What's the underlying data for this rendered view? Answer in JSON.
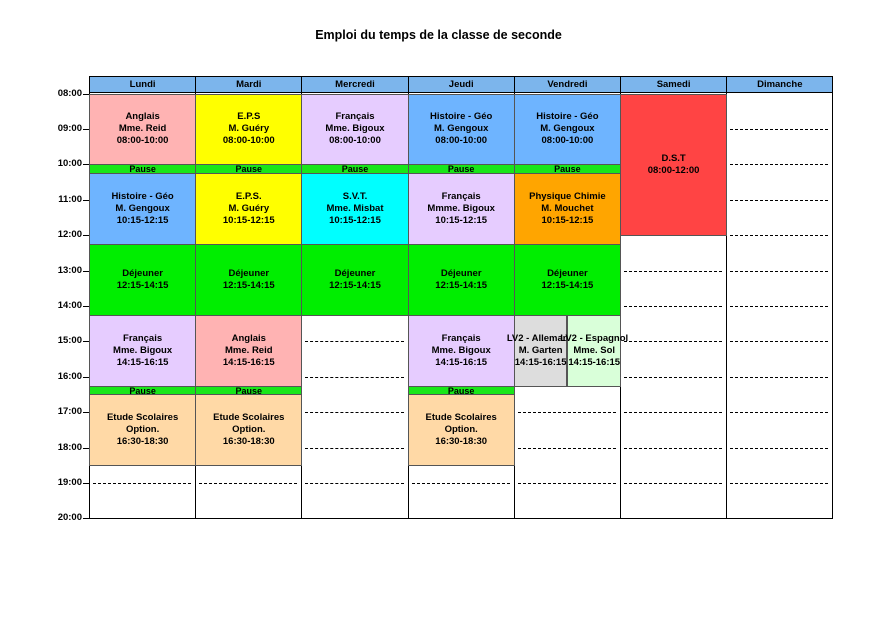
{
  "title": "Emploi du temps de la classe de seconde",
  "days": [
    "Lundi",
    "Mardi",
    "Mercredi",
    "Jeudi",
    "Vendredi",
    "Samedi",
    "Dimanche"
  ],
  "hours": [
    "08:00",
    "09:00",
    "10:00",
    "11:00",
    "12:00",
    "13:00",
    "14:00",
    "15:00",
    "16:00",
    "17:00",
    "18:00",
    "19:00",
    "20:00"
  ],
  "colors": {
    "header": "#7cb5ec",
    "anglais": "#ffb3b3",
    "eps": "#ffff00",
    "francais": "#e6ccff",
    "histoire": "#6eb4ff",
    "pause": "#19e619",
    "svt": "#00ffff",
    "physique": "#ffa500",
    "dejeuner": "#00ee00",
    "etude": "#ffd9a6",
    "dst": "#ff4444",
    "lv2_allemand": "#dddddd",
    "lv2_espagnol": "#d9ffd9"
  },
  "events": [
    {
      "day": 0,
      "start": 8.0,
      "end": 10.0,
      "color": "anglais",
      "lines": [
        "Anglais",
        "Mme. Reid",
        "08:00-10:00"
      ]
    },
    {
      "day": 1,
      "start": 8.0,
      "end": 10.0,
      "color": "eps",
      "lines": [
        "E.P.S",
        "M. Guéry",
        "08:00-10:00"
      ]
    },
    {
      "day": 2,
      "start": 8.0,
      "end": 10.0,
      "color": "francais",
      "lines": [
        "Français",
        "Mme. Bigoux",
        "08:00-10:00"
      ]
    },
    {
      "day": 3,
      "start": 8.0,
      "end": 10.0,
      "color": "histoire",
      "lines": [
        "Histoire - Géo",
        "M. Gengoux",
        "08:00-10:00"
      ]
    },
    {
      "day": 4,
      "start": 8.0,
      "end": 10.0,
      "color": "histoire",
      "lines": [
        "Histoire - Géo",
        "M. Gengoux",
        "08:00-10:00"
      ]
    },
    {
      "day": 5,
      "start": 8.0,
      "end": 12.0,
      "color": "dst",
      "lines": [
        "D.S.T",
        "08:00-12:00"
      ]
    },
    {
      "day": 0,
      "start": 10.0,
      "end": 10.25,
      "color": "pause",
      "pause": true,
      "lines": [
        "Pause"
      ]
    },
    {
      "day": 1,
      "start": 10.0,
      "end": 10.25,
      "color": "pause",
      "pause": true,
      "lines": [
        "Pause"
      ]
    },
    {
      "day": 2,
      "start": 10.0,
      "end": 10.25,
      "color": "pause",
      "pause": true,
      "lines": [
        "Pause"
      ]
    },
    {
      "day": 3,
      "start": 10.0,
      "end": 10.25,
      "color": "pause",
      "pause": true,
      "lines": [
        "Pause"
      ]
    },
    {
      "day": 4,
      "start": 10.0,
      "end": 10.25,
      "color": "pause",
      "pause": true,
      "lines": [
        "Pause"
      ]
    },
    {
      "day": 0,
      "start": 10.25,
      "end": 12.25,
      "color": "histoire",
      "lines": [
        "Histoire - Géo",
        "M. Gengoux",
        "10:15-12:15"
      ]
    },
    {
      "day": 1,
      "start": 10.25,
      "end": 12.25,
      "color": "eps",
      "lines": [
        "E.P.S.",
        "M. Guéry",
        "10:15-12:15"
      ]
    },
    {
      "day": 2,
      "start": 10.25,
      "end": 12.25,
      "color": "svt",
      "lines": [
        "S.V.T.",
        "Mme. Misbat",
        "10:15-12:15"
      ]
    },
    {
      "day": 3,
      "start": 10.25,
      "end": 12.25,
      "color": "francais",
      "lines": [
        "Français",
        "Mmme. Bigoux",
        "10:15-12:15"
      ]
    },
    {
      "day": 4,
      "start": 10.25,
      "end": 12.25,
      "color": "physique",
      "lines": [
        "Physique Chimie",
        "M. Mouchet",
        "10:15-12:15"
      ]
    },
    {
      "day": 0,
      "start": 12.25,
      "end": 14.25,
      "color": "dejeuner",
      "lines": [
        "Déjeuner",
        "12:15-14:15"
      ]
    },
    {
      "day": 1,
      "start": 12.25,
      "end": 14.25,
      "color": "dejeuner",
      "lines": [
        "Déjeuner",
        "12:15-14:15"
      ]
    },
    {
      "day": 2,
      "start": 12.25,
      "end": 14.25,
      "color": "dejeuner",
      "lines": [
        "Déjeuner",
        "12:15-14:15"
      ]
    },
    {
      "day": 3,
      "start": 12.25,
      "end": 14.25,
      "color": "dejeuner",
      "lines": [
        "Déjeuner",
        "12:15-14:15"
      ]
    },
    {
      "day": 4,
      "start": 12.25,
      "end": 14.25,
      "color": "dejeuner",
      "lines": [
        "Déjeuner",
        "12:15-14:15"
      ]
    },
    {
      "day": 0,
      "start": 14.25,
      "end": 16.25,
      "color": "francais",
      "lines": [
        "Français",
        "Mme. Bigoux",
        "14:15-16:15"
      ]
    },
    {
      "day": 1,
      "start": 14.25,
      "end": 16.25,
      "color": "anglais",
      "lines": [
        "Anglais",
        "Mme. Reid",
        "14:15-16:15"
      ]
    },
    {
      "day": 3,
      "start": 14.25,
      "end": 16.25,
      "color": "francais",
      "lines": [
        "Français",
        "Mme. Bigoux",
        "14:15-16:15"
      ]
    },
    {
      "day": 4,
      "start": 14.25,
      "end": 16.25,
      "color": "lv2_allemand",
      "half": 0,
      "lines": [
        "LV2 - Allemand",
        "M. Garten",
        "14:15-16:15"
      ]
    },
    {
      "day": 4,
      "start": 14.25,
      "end": 16.25,
      "color": "lv2_espagnol",
      "half": 1,
      "lines": [
        "LV2 - Espagnol",
        "Mme. Sol",
        "14:15-16:15"
      ]
    },
    {
      "day": 0,
      "start": 16.25,
      "end": 16.5,
      "color": "pause",
      "pause": true,
      "lines": [
        "Pause"
      ]
    },
    {
      "day": 1,
      "start": 16.25,
      "end": 16.5,
      "color": "pause",
      "pause": true,
      "lines": [
        "Pause"
      ]
    },
    {
      "day": 3,
      "start": 16.25,
      "end": 16.5,
      "color": "pause",
      "pause": true,
      "lines": [
        "Pause"
      ]
    },
    {
      "day": 0,
      "start": 16.5,
      "end": 18.5,
      "color": "etude",
      "lines": [
        "Etude Scolaires",
        "Option.",
        "16:30-18:30"
      ]
    },
    {
      "day": 1,
      "start": 16.5,
      "end": 18.5,
      "color": "etude",
      "lines": [
        "Etude Scolaires",
        "Option.",
        "16:30-18:30"
      ]
    },
    {
      "day": 3,
      "start": 16.5,
      "end": 18.5,
      "color": "etude",
      "lines": [
        "Etude Scolaires",
        "Option.",
        "16:30-18:30"
      ]
    }
  ]
}
